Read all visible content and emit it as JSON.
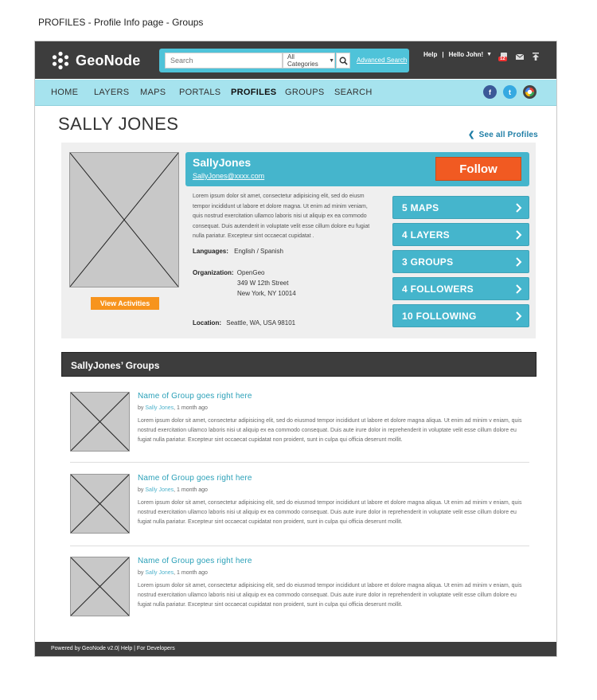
{
  "page_label": "PROFILES - Profile Info page - Groups",
  "header": {
    "logo_text": "GeoNode",
    "search_placeholder": "Search",
    "category_select": "All Categories",
    "advanced_search": "Advanced Search",
    "help": "Help",
    "separator": "|",
    "user_greeting": "Hello John!",
    "notification_count": "12"
  },
  "nav": {
    "items": [
      "HOME",
      "LAYERS",
      "MAPS",
      "PORTALS",
      "PROFILES",
      "GROUPS",
      "SEARCH"
    ],
    "active": "PROFILES",
    "social": {
      "facebook": "f",
      "twitter": "t"
    },
    "colors": {
      "facebook": "#3b5998",
      "twitter": "#35a9e1"
    }
  },
  "profile": {
    "page_title": "SALLY JONES",
    "see_all": "See all Profiles",
    "username": "SallyJones",
    "email": "SallyJones@xxxx.com",
    "follow_label": "Follow",
    "view_activities": "View Activities",
    "bio_lines": [
      "Lorem ipsum dolor sit amet, consectetur adipisicing elit, sed do eiusm",
      "tempor incididunt ut labore et dolore magna. Ut enim ad minim veniam,",
      "quis nostrud exercitation ullamco laboris nisi ut aliquip ex ea commodo",
      "consequat. Duis autenderit in voluptate velit esse cillum dolore eu fugiat",
      "nulla pariatur. Excepteur sint occaecat cupidatat ."
    ],
    "languages_label": "Languages:",
    "languages_value": "English / Spanish",
    "organization_label": "Organization:",
    "organization_name": "OpenGeo",
    "organization_street": "349 W 12th Street",
    "organization_city": "New York, NY 10014",
    "location_label": "Location:",
    "location_value": "Seattle, WA, USA 98101",
    "stats": [
      {
        "label": "5  MAPS"
      },
      {
        "label": "4  LAYERS"
      },
      {
        "label": "3  GROUPS"
      },
      {
        "label": "4  FOLLOWERS"
      },
      {
        "label": "10  FOLLOWING"
      }
    ]
  },
  "groups_section": {
    "title": "SallyJones’ Groups",
    "items": [
      {
        "name": "Name of Group goes right here",
        "by": "by ",
        "author": "Sally Jones",
        "time": ", 1 month ago",
        "desc": "Lorem ipsum dolor sit amet, consectetur adipisicing elit, sed do eiusmod tempor incididunt ut labore et dolore magna aliqua. Ut enim ad minim v eniam, quis nostrud exercitation ullamco laboris nisi ut aliquip ex ea commodo consequat. Duis aute irure dolor in reprehenderit in voluptate velit esse cillum dolore eu fugiat nulla pariatur. Excepteur sint occaecat cupidatat non proident, sunt in culpa qui officia deserunt mollit."
      },
      {
        "name": "Name of Group goes right here",
        "by": "by ",
        "author": "Sally Jones",
        "time": ", 1 month ago",
        "desc": "Lorem ipsum dolor sit amet, consectetur adipisicing elit, sed do eiusmod tempor incididunt ut labore et dolore magna aliqua. Ut enim ad minim v eniam, quis nostrud exercitation ullamco laboris nisi ut aliquip ex ea commodo consequat. Duis aute irure dolor in reprehenderit in voluptate velit esse cillum dolore eu fugiat nulla pariatur. Excepteur sint occaecat cupidatat non proident, sunt in culpa qui officia deserunt mollit."
      },
      {
        "name": "Name of Group goes right here",
        "by": "by ",
        "author": "Sally Jones",
        "time": ", 1 month ago",
        "desc": "Lorem ipsum dolor sit amet, consectetur adipisicing elit, sed do eiusmod tempor incididunt ut labore et dolore magna aliqua. Ut enim ad minim v eniam, quis nostrud exercitation ullamco laboris nisi ut aliquip ex ea commodo consequat. Duis aute irure dolor in reprehenderit in voluptate velit esse cillum dolore eu fugiat nulla pariatur. Excepteur sint occaecat cupidatat non proident, sunt in culpa qui officia deserunt mollit."
      }
    ]
  },
  "footer": {
    "text": "Powered by GeoNode v2.0| Help | For Developers"
  }
}
